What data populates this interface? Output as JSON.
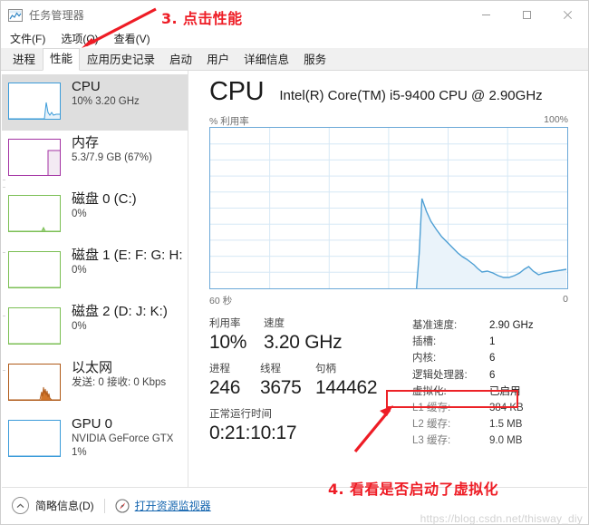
{
  "window": {
    "title": "任务管理器",
    "icon": "task-manager-icon",
    "minimize": "−",
    "maximize": "□",
    "close": "✕"
  },
  "menu": {
    "items": [
      {
        "label": "文件(F)"
      },
      {
        "label": "选项(O)"
      },
      {
        "label": "查看(V)"
      }
    ]
  },
  "tabs": {
    "active_index": 1,
    "items": [
      {
        "label": "进程"
      },
      {
        "label": "性能"
      },
      {
        "label": "应用历史记录"
      },
      {
        "label": "启动"
      },
      {
        "label": "用户"
      },
      {
        "label": "详细信息"
      },
      {
        "label": "服务"
      }
    ]
  },
  "sidebar": {
    "items": [
      {
        "name": "cpu",
        "title": "CPU",
        "sub": "10% 3.20 GHz",
        "sub2": "",
        "color": "#3a9bd9",
        "selected": true
      },
      {
        "name": "memory",
        "title": "内存",
        "sub": "5.3/7.9 GB (67%)",
        "sub2": "",
        "color": "#a332a3",
        "selected": false
      },
      {
        "name": "disk-0",
        "title": "磁盘 0 (C:)",
        "sub": "0%",
        "sub2": "",
        "color": "#7bbf54",
        "selected": false
      },
      {
        "name": "disk-1",
        "title": "磁盘 1 (E: F: G: H:",
        "sub": "0%",
        "sub2": "",
        "color": "#7bbf54",
        "selected": false
      },
      {
        "name": "disk-2",
        "title": "磁盘 2 (D: J: K:)",
        "sub": "0%",
        "sub2": "",
        "color": "#7bbf54",
        "selected": false
      },
      {
        "name": "ethernet",
        "title": "以太网",
        "sub": "发送: 0 接收: 0 Kbps",
        "sub2": "",
        "color": "#b05a18",
        "selected": false
      },
      {
        "name": "gpu-0",
        "title": "GPU 0",
        "sub": "NVIDIA GeForce GTX",
        "sub2": "1%",
        "color": "#3a9bd9",
        "selected": false
      }
    ]
  },
  "main": {
    "title": "CPU",
    "subtitle": "Intel(R) Core(TM) i5-9400 CPU @ 2.90GHz",
    "graph_axis_y_label": "% 利用率",
    "graph_axis_y_max": "100%",
    "graph_axis_x_left": "60 秒",
    "graph_axis_x_right": "0",
    "accent_color": "#3a9bd9",
    "stats_left": [
      {
        "labels": [
          "利用率",
          "速度"
        ],
        "values": [
          "10%",
          "3.20 GHz"
        ]
      },
      {
        "labels": [
          "进程",
          "线程",
          "句柄"
        ],
        "values": [
          "246",
          "3675",
          "144462"
        ]
      },
      {
        "labels": [
          "正常运行时间"
        ],
        "values": [
          "0:21:10:17"
        ]
      }
    ],
    "stats_right": [
      {
        "key": "基准速度:",
        "value": "2.90 GHz",
        "dim": false,
        "highlight": false
      },
      {
        "key": "插槽:",
        "value": "1",
        "dim": false,
        "highlight": false
      },
      {
        "key": "内核:",
        "value": "6",
        "dim": false,
        "highlight": false
      },
      {
        "key": "逻辑处理器:",
        "value": "6",
        "dim": false,
        "highlight": false
      },
      {
        "key": "虚拟化:",
        "value": "已启用",
        "dim": false,
        "highlight": true
      },
      {
        "key": "L1 缓存:",
        "value": "384 KB",
        "dim": true,
        "highlight": false
      },
      {
        "key": "L2 缓存:",
        "value": "1.5 MB",
        "dim": true,
        "highlight": false
      },
      {
        "key": "L3 缓存:",
        "value": "9.0 MB",
        "dim": true,
        "highlight": false
      }
    ],
    "highlight_color": "#ec2227"
  },
  "statusbar": {
    "fewer_details": "简略信息(D)",
    "fewer_details_icon": "chevron-up-icon",
    "resource_monitor": "打开资源监视器",
    "resource_monitor_icon": "gauge-icon"
  },
  "annotations": {
    "color": "#ee1c25",
    "note1": "3. 点击性能",
    "note2": "4. 看看是否启动了虚拟化"
  },
  "watermark": "https://blog.csdn.net/thisway_diy",
  "chart_data": {
    "type": "area",
    "title": "% 利用率",
    "xlabel": "60 秒",
    "ylabel": "% 利用率",
    "ylim": [
      0,
      100
    ],
    "xlim": [
      60,
      0
    ],
    "grid": true,
    "grid_rows": 10,
    "grid_cols": 6,
    "series": [
      {
        "name": "CPU 利用率",
        "color": "#3a9bd9",
        "fill": "#eef5fb",
        "x": [
          24.5,
          24.0,
          23.2,
          22.4,
          21.6,
          20.8,
          20.0,
          19.2,
          18.4,
          17.6,
          16.8,
          16.0,
          15.2,
          14.4,
          13.6,
          12.8,
          12.0,
          11.2,
          10.4,
          9.6,
          8.8,
          8.0,
          7.2,
          6.4,
          5.6,
          4.8,
          4.0,
          3.2,
          2.4,
          1.6,
          0.8,
          0.0
        ],
        "y": [
          0,
          22,
          56,
          48,
          42,
          38,
          34,
          31,
          28,
          25,
          22,
          19,
          17,
          15,
          12,
          10,
          11,
          10,
          9,
          7,
          6,
          6,
          7,
          8,
          10,
          13,
          11,
          8,
          9,
          10,
          10,
          11
        ]
      }
    ]
  }
}
